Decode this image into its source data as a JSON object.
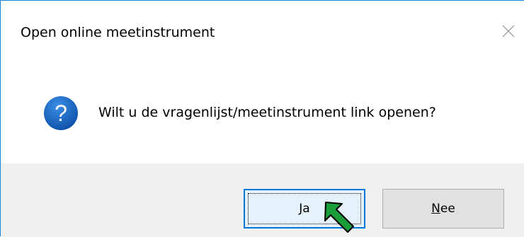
{
  "dialog": {
    "title": "Open online meetinstrument",
    "message": "Wilt u de vragenlijst/meetinstrument link openen?",
    "icon": "question-icon",
    "buttons": {
      "yes_label": "Ja",
      "no_label": "Nee"
    },
    "close_icon": "close-icon"
  },
  "colors": {
    "accent": "#0078d7",
    "icon_blue": "#1565c0",
    "footer_bg": "#f0f0f0",
    "cursor_green": "#1a9e3a"
  }
}
